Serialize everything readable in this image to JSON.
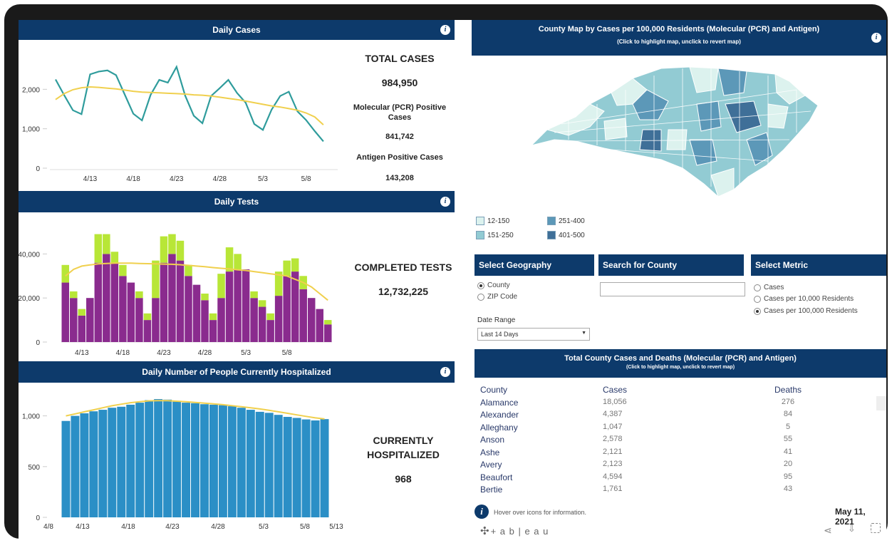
{
  "daily_cases": {
    "header": "Daily Cases",
    "total_title": "TOTAL CASES",
    "total_value": "984,950",
    "pcr_title": "Molecular (PCR) Positive Cases",
    "pcr_value": "841,742",
    "antigen_title": "Antigen Positive Cases",
    "antigen_value": "143,208"
  },
  "daily_tests": {
    "header": "Daily Tests",
    "completed_title": "COMPLETED TESTS",
    "completed_value": "12,732,225"
  },
  "hospitalized": {
    "header": "Daily Number of People Currently Hospitalized",
    "title_line1": "CURRENTLY",
    "title_line2": "HOSPITALIZED",
    "value": "968"
  },
  "map": {
    "header": "County Map by Cases per 100,000 Residents (Molecular (PCR) and Antigen)",
    "subheader": "(Click to highlight map, unclick to revert map)",
    "legend": [
      {
        "label": "12-150",
        "color": "#dcf2ee"
      },
      {
        "label": "251-400",
        "color": "#5c98b8"
      },
      {
        "label": "151-250",
        "color": "#92cbd3"
      },
      {
        "label": "401-500",
        "color": "#3f6f98"
      }
    ]
  },
  "filters": {
    "geo_header": "Select Geography",
    "geo_options": [
      "County",
      "ZIP Code"
    ],
    "search_header": "Search for County",
    "search_value": "",
    "metric_header": "Select Metric",
    "metric_options": [
      "Cases",
      "Cases per 10,000 Residents",
      "Cases per 100,000 Residents"
    ],
    "date_label": "Date Range",
    "date_value": "Last 14 Days"
  },
  "county_table": {
    "header": "Total County Cases and Deaths (Molecular (PCR) and Antigen)",
    "subheader": "(Click to highlight map, unclick to revert map)",
    "columns": [
      "County",
      "Cases",
      "Deaths"
    ],
    "rows": [
      [
        "Alamance",
        "18,056",
        "276"
      ],
      [
        "Alexander",
        "4,387",
        "84"
      ],
      [
        "Alleghany",
        "1,047",
        "5"
      ],
      [
        "Anson",
        "2,578",
        "55"
      ],
      [
        "Ashe",
        "2,121",
        "41"
      ],
      [
        "Avery",
        "2,123",
        "20"
      ],
      [
        "Beaufort",
        "4,594",
        "95"
      ],
      [
        "Bertie",
        "1,761",
        "43"
      ]
    ]
  },
  "footer": {
    "hover_text": "Hover over icons for information.",
    "date": "May 11, 2021",
    "brand": "+ a b | e a u"
  },
  "chart_data": [
    {
      "type": "line",
      "name": "daily-cases",
      "x": [
        "4/9",
        "4/10",
        "4/11",
        "4/12",
        "4/13",
        "4/14",
        "4/15",
        "4/16",
        "4/17",
        "4/18",
        "4/19",
        "4/20",
        "4/21",
        "4/22",
        "4/23",
        "4/24",
        "4/25",
        "4/26",
        "4/27",
        "4/28",
        "4/29",
        "4/30",
        "5/1",
        "5/2",
        "5/3",
        "5/4",
        "5/5",
        "5/6",
        "5/7",
        "5/8",
        "5/9",
        "5/10",
        "5/11"
      ],
      "xticks": [
        "4/13",
        "4/18",
        "4/23",
        "4/28",
        "5/3",
        "5/8"
      ],
      "yticks": [
        "0",
        "1,000",
        "2,000"
      ],
      "ylim": [
        0,
        3000
      ],
      "series": [
        {
          "values": [
            2250,
            1850,
            1470,
            1370,
            2380,
            2450,
            2480,
            2360,
            1870,
            1380,
            1210,
            1860,
            2240,
            2170,
            2570,
            1840,
            1330,
            1140,
            1830,
            2030,
            2240,
            1910,
            1660,
            1120,
            970,
            1480,
            1830,
            1940,
            1440,
            1220,
            940,
            680,
            null
          ]
        },
        {
          "values": [
            1740,
            1890,
            1990,
            2040,
            2060,
            2050,
            2030,
            2010,
            1980,
            1950,
            1930,
            1920,
            1910,
            1900,
            1890,
            1880,
            1860,
            1850,
            1830,
            1800,
            1770,
            1740,
            1700,
            1660,
            1620,
            1580,
            1550,
            1510,
            1470,
            1400,
            1300,
            1100,
            null
          ]
        }
      ],
      "colors": [
        "#2f9c9c",
        "#f0d04e"
      ]
    },
    {
      "type": "bar",
      "name": "daily-tests",
      "xticks": [
        "4/13",
        "4/18",
        "4/23",
        "4/28",
        "5/3",
        "5/8"
      ],
      "yticks": [
        "0",
        "20,000",
        "40,000"
      ],
      "ylim": [
        0,
        55000
      ],
      "series": [
        {
          "name": "Molecular (PCR)",
          "color": "#8a2b8e",
          "values": [
            27000,
            20000,
            12000,
            20000,
            36000,
            40000,
            36000,
            30000,
            27000,
            20000,
            10000,
            20000,
            36000,
            40000,
            37000,
            30000,
            26000,
            19000,
            10000,
            20000,
            32000,
            33000,
            33000,
            20000,
            16000,
            10000,
            21000,
            30000,
            32000,
            24000,
            20000,
            15000,
            8000
          ]
        },
        {
          "name": "Antigen",
          "color": "#b8e637",
          "values": [
            8000,
            3000,
            3000,
            0,
            13000,
            9000,
            5000,
            5000,
            0,
            3000,
            3000,
            17000,
            12000,
            9000,
            9000,
            5000,
            0,
            3000,
            3000,
            11000,
            11000,
            7000,
            0,
            3000,
            3000,
            3000,
            11000,
            7000,
            6000,
            6000,
            0,
            0,
            2000
          ]
        }
      ],
      "trend": {
        "color": "#f0d04e",
        "values": [
          30000,
          33000,
          34500,
          35000,
          35500,
          35700,
          35800,
          35800,
          35800,
          35700,
          35600,
          35500,
          35400,
          35300,
          35100,
          34800,
          34500,
          34200,
          33800,
          33500,
          33200,
          32800,
          32500,
          32000,
          31500,
          31000,
          30500,
          30000,
          28500,
          27000,
          25000,
          22000,
          19000
        ]
      }
    },
    {
      "type": "bar",
      "name": "hospitalized",
      "xticks": [
        "4/8",
        "4/13",
        "4/18",
        "4/23",
        "4/28",
        "5/3",
        "5/8",
        "5/13"
      ],
      "yticks": [
        "0",
        "500",
        "1,000"
      ],
      "ylim": [
        0,
        1250
      ],
      "series": [
        {
          "name": "Hospitalized",
          "color": "#2b8fc6",
          "values": [
            950,
            1000,
            1025,
            1045,
            1060,
            1080,
            1090,
            1110,
            1130,
            1155,
            1165,
            1160,
            1140,
            1130,
            1125,
            1115,
            1110,
            1105,
            1095,
            1080,
            1060,
            1040,
            1030,
            1010,
            990,
            980,
            965,
            955,
            968
          ]
        }
      ],
      "trend": {
        "color": "#f0d04e",
        "values": [
          1000,
          1020,
          1040,
          1060,
          1080,
          1100,
          1115,
          1130,
          1140,
          1148,
          1150,
          1150,
          1145,
          1140,
          1132,
          1125,
          1118,
          1110,
          1100,
          1090,
          1080,
          1068,
          1055,
          1040,
          1025,
          1010,
          995,
          980,
          970
        ]
      }
    }
  ]
}
